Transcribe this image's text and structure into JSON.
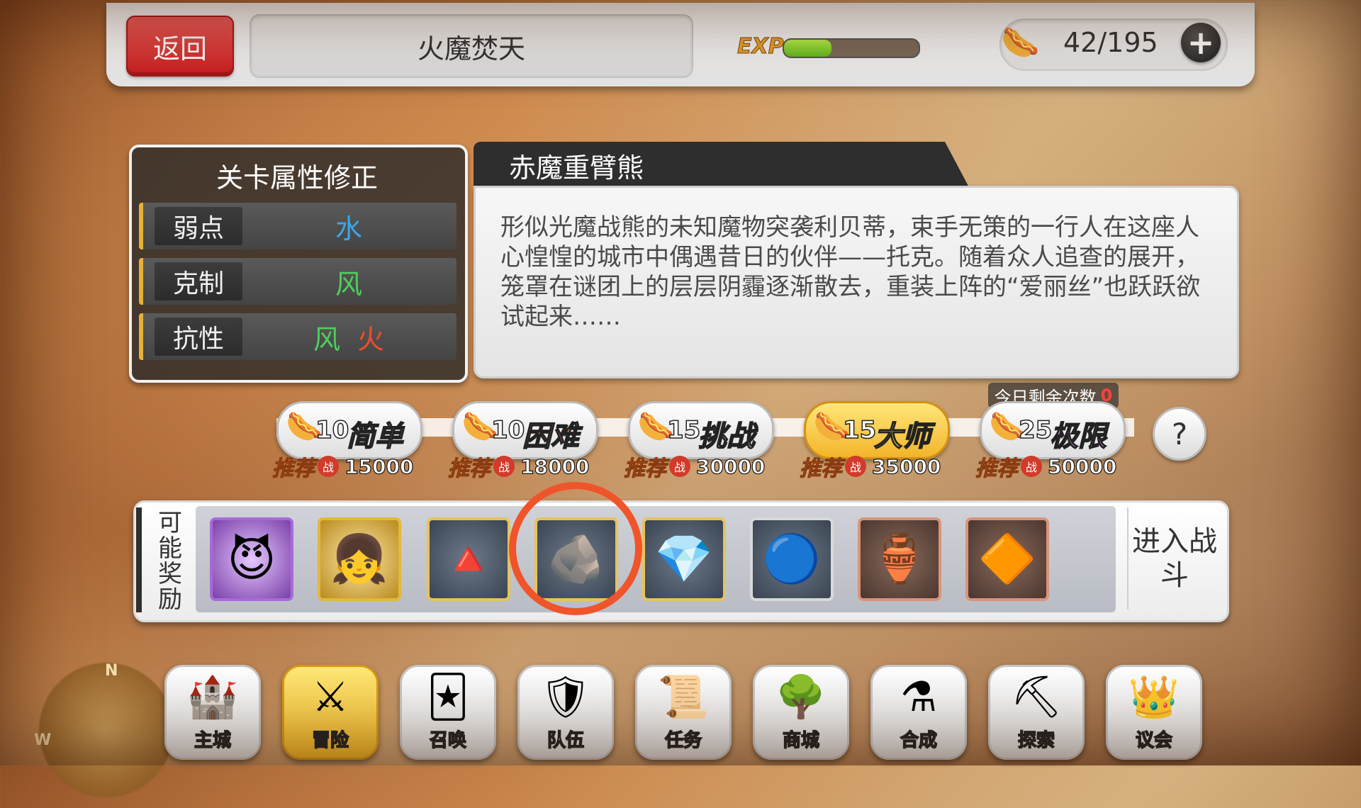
{
  "header": {
    "back_label": "返回",
    "stage_title": "火魔焚天",
    "exp_label": "EXP",
    "exp_progress": 0.35,
    "stamina_icon": "hotdog-icon",
    "stamina_text": "42/195",
    "add_icon": "+"
  },
  "attributes": {
    "title": "关卡属性修正",
    "rows": [
      {
        "label": "弱点",
        "values": [
          {
            "text": "水",
            "color": "#3aa7e8"
          }
        ]
      },
      {
        "label": "克制",
        "values": [
          {
            "text": "风",
            "color": "#4ccf5a"
          }
        ]
      },
      {
        "label": "抗性",
        "values": [
          {
            "text": "风",
            "color": "#4ccf5a"
          },
          {
            "text": "火",
            "color": "#f24a2a"
          }
        ]
      }
    ]
  },
  "boss": {
    "name": "赤魔重臂熊",
    "description": "形似光魔战熊的未知魔物突袭利贝蒂，束手无策的一行人在这座人心惶惶的城市中偶遇昔日的伙伴——托克。随着众人追查的展开，笼罩在谜团上的层层阴霾逐渐散去，重装上阵的“爱丽丝”也跃跃欲试起来……"
  },
  "difficulties": [
    {
      "cost": "10",
      "name": "简单",
      "name_color": "#6fe05a",
      "rec_label": "推荐",
      "badge": "战",
      "power": "15000",
      "selected": false
    },
    {
      "cost": "10",
      "name": "困难",
      "name_color": "#f26a4a",
      "rec_label": "推荐",
      "badge": "战",
      "power": "18000",
      "selected": false
    },
    {
      "cost": "15",
      "name": "挑战",
      "name_color": "#f0f0f0",
      "rec_label": "推荐",
      "badge": "战",
      "power": "30000",
      "selected": false
    },
    {
      "cost": "15",
      "name": "大师",
      "name_color": "#ffe24a",
      "rec_label": "推荐",
      "badge": "战",
      "power": "35000",
      "selected": true
    },
    {
      "cost": "25",
      "name": "极限",
      "name_color": "#d98cff",
      "rec_label": "推荐",
      "badge": "战",
      "power": "50000",
      "selected": false
    }
  ],
  "daily_remaining": {
    "label": "今日剩余次数",
    "count": "0"
  },
  "help_label": "?",
  "rewards": {
    "label": "可能奖励",
    "items": [
      {
        "icon": "demon-girl-portrait",
        "glyph": "😈",
        "frame": "r-purple"
      },
      {
        "icon": "blonde-girl-portrait",
        "glyph": "👧",
        "frame": "r-gold"
      },
      {
        "icon": "green-crystal-icon",
        "glyph": "🔺",
        "frame": "r-goldframe"
      },
      {
        "icon": "silver-ore-icon",
        "glyph": "🪨",
        "frame": "r-goldframe"
      },
      {
        "icon": "emerald-gem-icon",
        "glyph": "💎",
        "frame": "r-goldframe"
      },
      {
        "icon": "blue-flame-crystal-icon",
        "glyph": "🔵",
        "frame": "r-silver"
      },
      {
        "icon": "powder-jar-icon",
        "glyph": "🏺",
        "frame": "r-copper"
      },
      {
        "icon": "amber-crystal-icon",
        "glyph": "🔶",
        "frame": "r-copper"
      }
    ],
    "enter_battle": "进入战斗"
  },
  "nav": [
    {
      "label": "主城",
      "icon": "castle-icon",
      "glyph": "🏰",
      "active": false
    },
    {
      "label": "冒险",
      "icon": "crossed-swords-icon",
      "glyph": "⚔",
      "active": true
    },
    {
      "label": "召唤",
      "icon": "summon-card-icon",
      "glyph": "🃏",
      "active": false
    },
    {
      "label": "队伍",
      "icon": "winged-emblem-icon",
      "glyph": "🛡",
      "active": false
    },
    {
      "label": "任务",
      "icon": "quest-book-icon",
      "glyph": "📜",
      "active": false
    },
    {
      "label": "商城",
      "icon": "shop-tree-icon",
      "glyph": "🌳",
      "active": false
    },
    {
      "label": "合成",
      "icon": "potion-flask-icon",
      "glyph": "⚗",
      "active": false
    },
    {
      "label": "探索",
      "icon": "shovel-icon",
      "glyph": "⛏",
      "active": false
    },
    {
      "label": "议会",
      "icon": "council-crest-icon",
      "glyph": "👑",
      "active": false
    }
  ],
  "compass": {
    "n": "N",
    "w": "W"
  }
}
